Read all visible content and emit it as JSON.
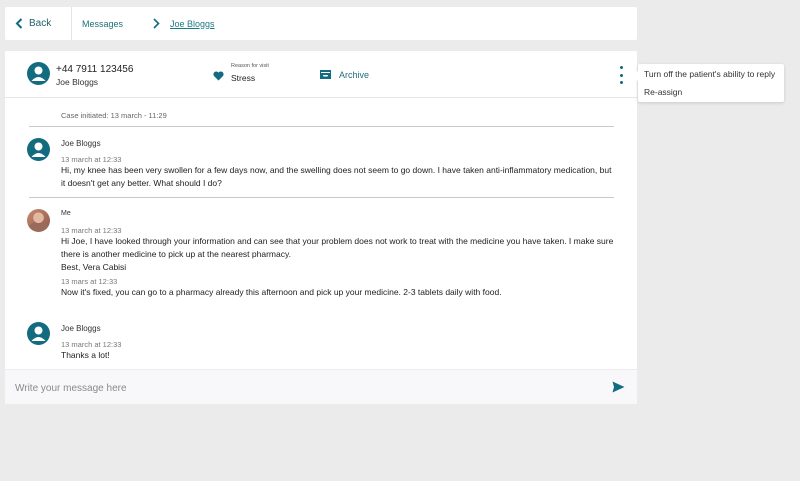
{
  "nav": {
    "back_label": "Back",
    "crumb_messages": "Messages",
    "crumb_current": "Joe Bloggs"
  },
  "header": {
    "phone": "+44 7911 123456",
    "name": "Joe Bloggs",
    "reason_label": "Reason for visit",
    "reason_value": "Stress",
    "archive_label": "Archive"
  },
  "case_initiated": "Case initiated: 13 march - 11:29",
  "messages": [
    {
      "author": "Joe Bloggs",
      "time": "13 march at 12:33",
      "text": "Hi, my knee has been very swollen for a few days now, and the swelling does not seem to go down. I have taken anti-inflammatory medication, but it doesn't get any better. What should I do?"
    },
    {
      "author": "Me",
      "time": "13 march at 12:33",
      "text_line1": "Hi Joe, I have looked through your information and can see that your problem does not work to treat with the medicine you have taken. I make sure there is another medicine to pick up at the nearest pharmacy.",
      "text_line2": "Best, Vera Cabisi",
      "time2": "13 mars at 12:33",
      "text2": "Now it's fixed, you can go to a pharmacy already this afternoon and pick up your medicine. 2-3 tablets daily with food."
    },
    {
      "author": "Joe Bloggs",
      "time": "13 march at 12:33",
      "text": "Thanks a lot!"
    }
  ],
  "composer": {
    "placeholder": "Write your message here"
  },
  "menu": {
    "item1": "Turn off the patient's ability to reply",
    "item2": "Re-assign"
  },
  "colors": {
    "accent": "#126b7e",
    "link": "#1f6f78",
    "background": "#ebebec"
  }
}
